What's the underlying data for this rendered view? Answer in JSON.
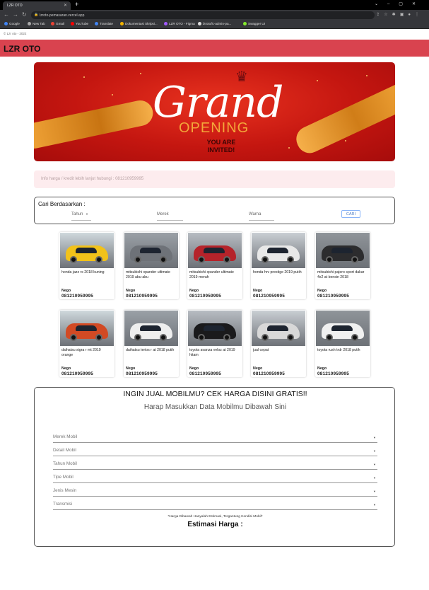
{
  "browser": {
    "tab_title": "LZR OTO",
    "url": "lzroto-pemasaran.vercel.app",
    "bookmarks": [
      "Google",
      "New Tab",
      "Gmail",
      "YouTube",
      "Translate",
      "Dokumentasi Skripsi...",
      "LZR OTO - Figma",
      "lzroto/lc-admin-pa...",
      "Swagger UI"
    ]
  },
  "page": {
    "copyright": "© Lzr oto - 2022",
    "brand": "LZR OTO",
    "banner": {
      "title": "Grand",
      "subtitle": "OPENING",
      "tagline": "YOU ARE INVITED!"
    },
    "info": "Info harga / kredit lebih lanjut hubungi : 081210959995",
    "search": {
      "label": "Cari Berdasarkan :",
      "fields": [
        "Tahun",
        "Merek",
        "Warna"
      ],
      "button": "CARI"
    },
    "cars": [
      {
        "name": "honda jazz rs 2018 kuning",
        "price": "Nego",
        "phone": "081210959995",
        "color": "#f2c21a"
      },
      {
        "name": "mitsubishi xpander ultimate 2019 abu-abu",
        "price": "Nego",
        "phone": "081210959995",
        "color": "#6e7278"
      },
      {
        "name": "mitsubishi xpander ultimate 2019 merah",
        "price": "Nego",
        "phone": "081210959995",
        "color": "#b5232a"
      },
      {
        "name": "honda hrv prestige 2019 putih",
        "price": "Nego",
        "phone": "081210959995",
        "color": "#e8e8e8"
      },
      {
        "name": "mitsubishi pajero sport dakar 4x2 at bensin 2018",
        "price": "Nego",
        "phone": "081210959995",
        "color": "#2c2c2e"
      },
      {
        "name": "daihatsu sigra r mt 2019 orange",
        "price": "Nego",
        "phone": "081210959995",
        "color": "#d24a24"
      },
      {
        "name": "daihatsu terios r at 2018 putih",
        "price": "Nego",
        "phone": "081210959995",
        "color": "#eeeeee"
      },
      {
        "name": "toyota avanza veloz at 2019 hitam",
        "price": "Nego",
        "phone": "081210959995",
        "color": "#1a1a1c"
      },
      {
        "name": "jual cepat",
        "price": "Nego",
        "phone": "081210959995",
        "color": "#d8d8d8"
      },
      {
        "name": "toyota rush trdr 2018 putih",
        "price": "Nego",
        "phone": "081210959995",
        "color": "#f0f0f0"
      }
    ],
    "sell": {
      "heading": "INGIN JUAL MOBILMU? CEK HARGA DISINI GRATIS!!",
      "subheading": "Harap Masukkan Data Mobilmu Dibawah Sini",
      "selects": [
        "Merek Mobil",
        "Detail Mobil",
        "Tahun Mobil",
        "Tipe Mobil",
        "Jenis Mesin",
        "Transmisi"
      ],
      "note": "*Harga Dibawah Hanyalah Estimasi, Tergantung Kondisi Mobil*",
      "estimate_label": "Estimasi Harga :"
    }
  }
}
